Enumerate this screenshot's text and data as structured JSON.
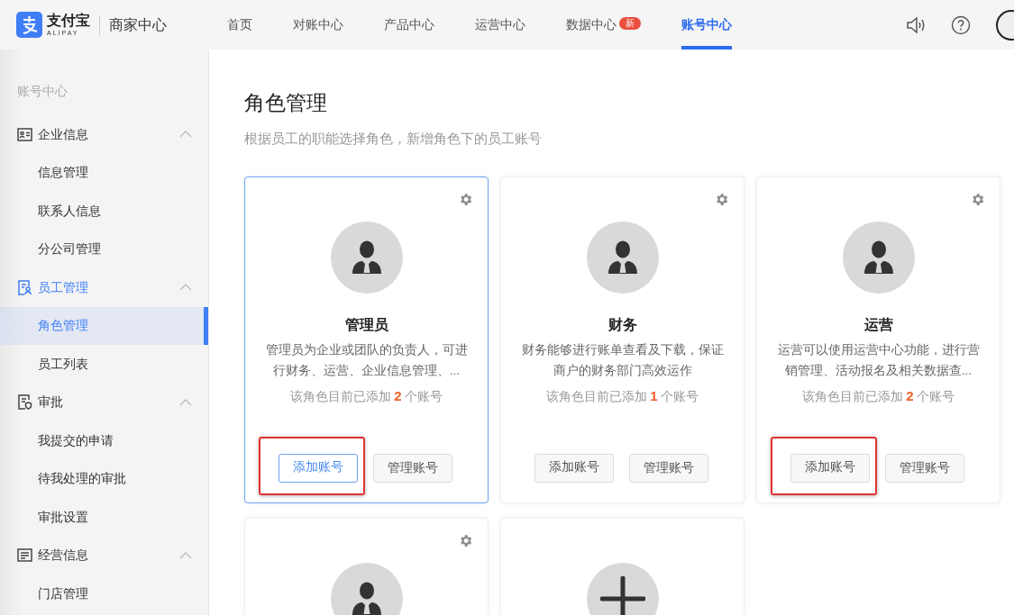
{
  "header": {
    "logo": {
      "name": "支付宝",
      "sub": "ALIPAY"
    },
    "product": "商家中心",
    "nav": [
      {
        "label": "首页",
        "selected": false
      },
      {
        "label": "对账中心",
        "selected": false
      },
      {
        "label": "产品中心",
        "selected": false
      },
      {
        "label": "运营中心",
        "selected": false
      },
      {
        "label": "数据中心",
        "selected": false,
        "badge": "新"
      },
      {
        "label": "账号中心",
        "selected": true
      }
    ]
  },
  "sidebar": {
    "title": "账号中心",
    "groups": [
      {
        "label": "企业信息",
        "kind": "id",
        "expanded": true,
        "children": [
          {
            "label": "信息管理",
            "selected": false
          },
          {
            "label": "联系人信息",
            "selected": false
          },
          {
            "label": "分公司管理",
            "selected": false
          }
        ]
      },
      {
        "label": "员工管理",
        "kind": "staff",
        "expanded": true,
        "children": [
          {
            "label": "角色管理",
            "selected": true
          },
          {
            "label": "员工列表",
            "selected": false
          }
        ]
      },
      {
        "label": "审批",
        "kind": "approval",
        "expanded": true,
        "children": [
          {
            "label": "我提交的申请",
            "selected": false
          },
          {
            "label": "待我处理的审批",
            "selected": false
          },
          {
            "label": "审批设置",
            "selected": false
          }
        ]
      },
      {
        "label": "经营信息",
        "kind": "list",
        "expanded": true,
        "children": [
          {
            "label": "门店管理",
            "selected": false
          }
        ]
      }
    ]
  },
  "page": {
    "title": "角色管理",
    "subtitle": "根据员工的职能选择角色，新增角色下的员工账号",
    "cards": [
      {
        "kind": "role",
        "selected": true,
        "title": "管理员",
        "description": "管理员为企业或团队的负责人，可进行财务、运营、企业信息管理、...",
        "count_prefix": "该角色目前已添加",
        "count": "2",
        "count_suffix": "个账号",
        "add_button": "添加账号",
        "manage_button": "管理账号",
        "highlighted": true
      },
      {
        "kind": "role",
        "selected": false,
        "title": "财务",
        "description": "财务能够进行账单查看及下载，保证商户的财务部门高效运作",
        "count_prefix": "该角色目前已添加",
        "count": "1",
        "count_suffix": "个账号",
        "add_button": "添加账号",
        "manage_button": "管理账号",
        "highlighted": false
      },
      {
        "kind": "role",
        "selected": false,
        "title": "运营",
        "description": "运营可以使用运营中心功能，进行营销管理、活动报名及相关数据查...",
        "count_prefix": "该角色目前已添加",
        "count": "2",
        "count_suffix": "个账号",
        "add_button": "添加账号",
        "manage_button": "管理账号",
        "highlighted": true
      },
      {
        "kind": "role",
        "selected": false
      },
      {
        "kind": "add"
      }
    ]
  }
}
